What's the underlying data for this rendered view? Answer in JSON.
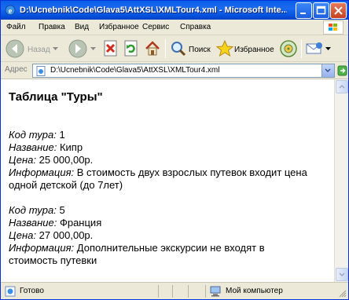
{
  "window": {
    "title": "D:\\Ucnebnik\\Code\\Glava5\\AttXSL\\XMLTour4.xml - Microsoft Inte..."
  },
  "menu": {
    "items": [
      "Файл",
      "Правка",
      "Вид",
      "Избранное",
      "Сервис",
      "Справка"
    ]
  },
  "toolbar": {
    "back_label": "Назад",
    "search_label": "Поиск",
    "favorites_label": "Избранное",
    "icons": [
      "back-arrow-icon",
      "forward-arrow-icon",
      "stop-icon",
      "refresh-icon",
      "home-icon",
      "search-icon",
      "favorites-star-icon",
      "media-icon",
      "mail-icon"
    ]
  },
  "address": {
    "label": "Адрес",
    "value": "D:\\Ucnebnik\\Code\\Glava5\\AttXSL\\XMLTour4.xml"
  },
  "content": {
    "title": "Таблица \"Туры\"",
    "tours": [
      {
        "code_label": "Код тура:",
        "code": "1",
        "name_label": "Название:",
        "name": "Кипр",
        "price_label": "Цена:",
        "price": "25 000,00р.",
        "info_label": "Информация:",
        "info_line1": "В стоимость двух взрослых путевок входит цена",
        "info_line2": "одной детской (до 7лет)"
      },
      {
        "code_label": "Код тура:",
        "code": "5",
        "name_label": "Название:",
        "name": "Франция",
        "price_label": "Цена:",
        "price": "27 000,00р.",
        "info_label": "Информация:",
        "info_line1": "Дополнительные экскурсии не входят в",
        "info_line2": "стоимость путевки"
      }
    ]
  },
  "status": {
    "text": "Готово",
    "zone": "Мой компьютер"
  },
  "colors": {
    "titlebar": "#0a5fe8",
    "chrome": "#ece9d8",
    "close_button": "#c5401f"
  }
}
